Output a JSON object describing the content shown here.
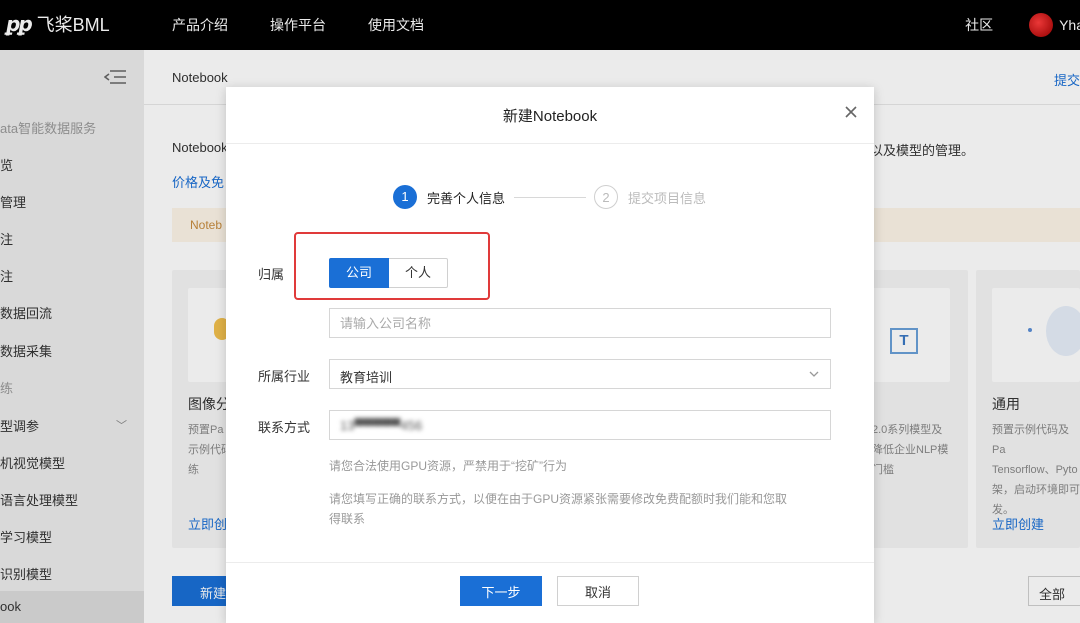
{
  "topbar": {
    "logo_mark": "꾸꾸",
    "logo_text": "飞桨BML",
    "nav": [
      "产品介绍",
      "操作平台",
      "使用文档"
    ],
    "community": "社区",
    "user": "Yha"
  },
  "sidebar": {
    "items": [
      {
        "label": "ata智能数据服务",
        "grey": true
      },
      {
        "label": "览"
      },
      {
        "label": "管理"
      },
      {
        "label": "注"
      },
      {
        "label": "注"
      },
      {
        "label": "数据回流"
      },
      {
        "label": "数据采集"
      },
      {
        "label": "练",
        "grey": true
      },
      {
        "label": "型调参"
      },
      {
        "label": "机视觉模型"
      },
      {
        "label": "语言处理模型"
      },
      {
        "label": "学习模型"
      },
      {
        "label": "识别模型"
      },
      {
        "label": "ook",
        "active": true
      }
    ]
  },
  "main": {
    "breadcrumb": "Notebook",
    "submit_link": "提交",
    "intro_left": "Notebook",
    "intro_right": "以及模型的管理。",
    "price_link": "价格及免",
    "notice": "Noteb",
    "cards": [
      {
        "title": "图像分",
        "desc": [
          "预置Pa",
          "示例代码",
          "练"
        ],
        "link": "立即创"
      },
      {
        "title": "",
        "desc": [
          "2.0系列模型及",
          "降低企业NLP模",
          "门槛"
        ],
        "link": ""
      },
      {
        "title": "通用",
        "desc": [
          "预置示例代码及Pa",
          "Tensorflow、Pyto",
          "架，启动环境即可",
          "发。"
        ],
        "link": "立即创建"
      }
    ],
    "create_button": "新建",
    "all_select": "全部"
  },
  "modal": {
    "title": "新建Notebook",
    "steps": [
      {
        "num": "1",
        "label": "完善个人信息",
        "active": true
      },
      {
        "num": "2",
        "label": "提交项目信息",
        "active": false
      }
    ],
    "ownership_label": "归属",
    "ownership_options": [
      "公司",
      "个人"
    ],
    "ownership_selected": "公司",
    "company_placeholder": "请输入公司名称",
    "industry_label": "所属行业",
    "industry_value": "教育培训",
    "contact_label": "联系方式",
    "contact_value": "13▀▀▀▀▀456",
    "hint1": "请您合法使用GPU资源，严禁用于“挖矿”行为",
    "hint2_line1": "请您填写正确的联系方式，以便在由于GPU资源紧张需要修改免费配额时我们能和您取",
    "hint2_line2": "得联系",
    "next_button": "下一步",
    "cancel_button": "取消"
  },
  "colors": {
    "primary": "#1a6fd6",
    "highlight": "#e03a3a",
    "topbar": "#000000"
  }
}
